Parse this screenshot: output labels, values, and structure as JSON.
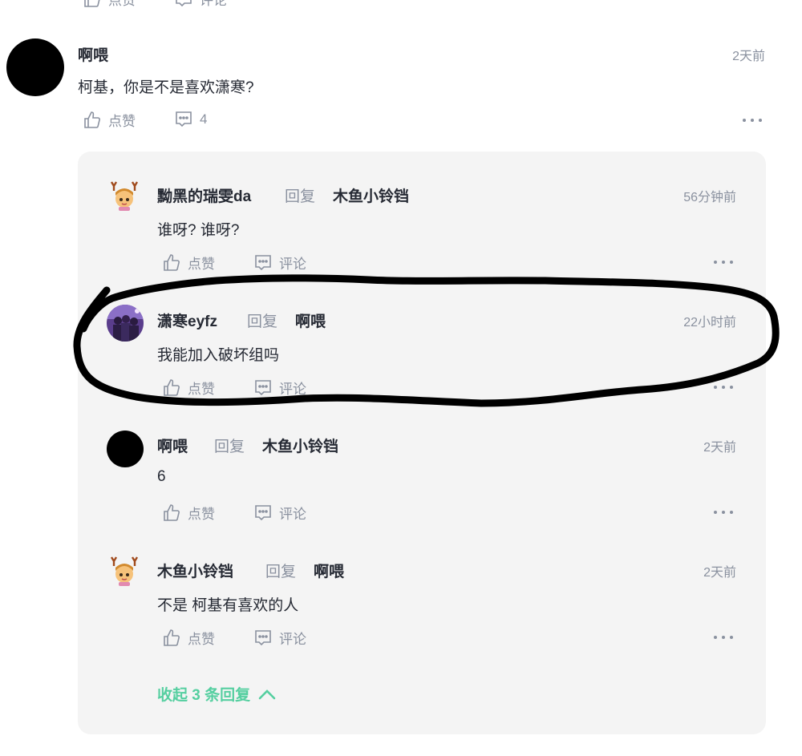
{
  "top_partial": {
    "like_label": "点赞",
    "comment_label": "评论"
  },
  "main_comment": {
    "author": "啊喂",
    "time": "2天前",
    "text": "柯基，你是不是喜欢潇寒?",
    "like_label": "点赞",
    "comment_count": "4"
  },
  "replies": [
    {
      "author": "黝黑的瑞雯da",
      "reply_word": "回复",
      "target": "木鱼小铃铛",
      "time": "56分钟前",
      "text": "谁呀? 谁呀?",
      "like_label": "点赞",
      "comment_label": "评论",
      "avatar": "anime-deer-avatar"
    },
    {
      "author": "潇寒eyfz",
      "reply_word": "回复",
      "target": "啊喂",
      "time": "22小时前",
      "text": "我能加入破坏组吗",
      "like_label": "点赞",
      "comment_label": "评论",
      "avatar": "purple-group-avatar"
    },
    {
      "author": "啊喂",
      "reply_word": "回复",
      "target": "木鱼小铃铛",
      "time": "2天前",
      "text": "6",
      "like_label": "点赞",
      "comment_label": "评论",
      "avatar": "black-circle-avatar"
    },
    {
      "author": "木鱼小铃铛",
      "reply_word": "回复",
      "target": "啊喂",
      "time": "2天前",
      "text": "不是 柯基有喜欢的人",
      "like_label": "点赞",
      "comment_label": "评论",
      "avatar": "anime-deer-avatar"
    }
  ],
  "collapse_label": "收起 3 条回复",
  "colors": {
    "accent_green": "#55cfa0",
    "panel_bg": "#f4f4f4",
    "muted": "#8a919f",
    "text": "#252933"
  }
}
